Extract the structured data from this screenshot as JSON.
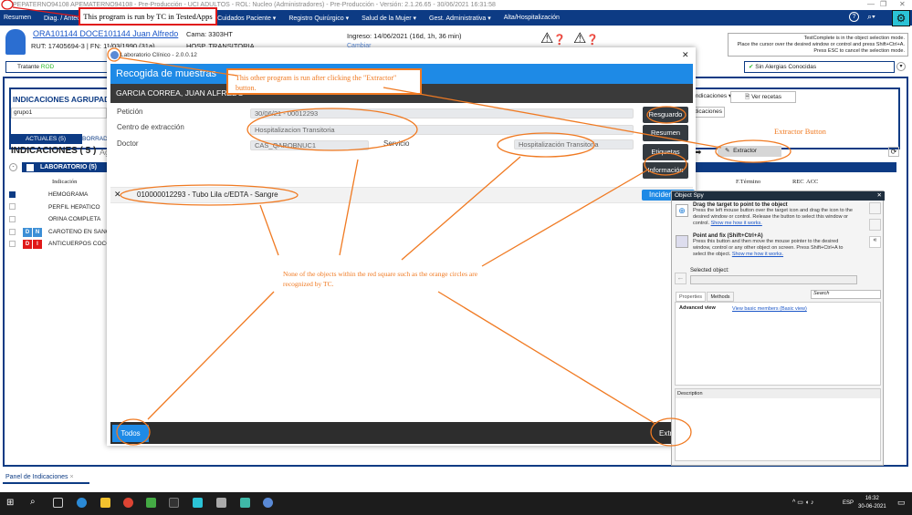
{
  "window": {
    "title": "PEPATERNO94108 APEMATERNO94108 - Pre-Producción - UCI ADULTOS - ROL: Nucleo (Administradores) - Pre-Producción - Versión: 2.1.26.65 - 30/06/2021 16:31:58"
  },
  "menu": [
    "Resumen",
    "Diag. / Antec.",
    "Cuidados Paciente",
    "Registro Quirúrgico",
    "Salud de la Mujer",
    "Gest. Administrativa",
    "Alta/Hospitalización"
  ],
  "patient": {
    "name": "ORA101144 DOCE101144 Juan Alfredo",
    "rut": "RUT: 17405694-3 | FN: 11/03/1990 (31a)",
    "cama": "Cama: 3303HT",
    "unit": "HOSP. TRANSITORIA",
    "ingreso": "Ingreso: 14/06/2021 (16d, 1h, 36 min)",
    "cambiar": "Cambiar"
  },
  "tooltip": [
    "TestComplete is in the object selection mode.",
    "Place the cursor over the desired window or control and press Shift+Ctrl+A.",
    "Press ESC to cancel the selection mode."
  ],
  "tratante": {
    "label": "Tratante",
    "value": "ROD"
  },
  "alergias": "Sin Alergias Conocidas",
  "agrupadas": {
    "title": "INDICACIONES AGRUPADAS",
    "group": "grupo1",
    "dropdown": "Indicaciones",
    "btn": "Indicaciones",
    "ver_recetas": "Ver recetas"
  },
  "tabs": {
    "actuales": "ACTUALES (5)",
    "borradores": "BORRADORES"
  },
  "indicaciones_title": "INDICACIONES ( 5 )",
  "agregar": "Ag",
  "laboratorio": "LABORATORIO  (5)",
  "columns": {
    "indicacion": "Indicación",
    "termino": "F.Término",
    "rec": "REC",
    "acc": "ACC"
  },
  "rows": [
    {
      "name": "HEMOGRAMA",
      "checked": true,
      "badges": []
    },
    {
      "name": "PERFIL HEPATICO",
      "checked": false,
      "badges": []
    },
    {
      "name": "ORINA COMPLETA",
      "checked": false,
      "badges": []
    },
    {
      "name": "CAROTENO EN SANGRE",
      "checked": false,
      "badges": [
        {
          "t": "D",
          "c": "#3d8fd6"
        },
        {
          "t": "N",
          "c": "#3d8fd6"
        }
      ]
    },
    {
      "name": "ANTICUERPOS COCCIDIOIDES",
      "checked": false,
      "badges": [
        {
          "t": "D",
          "c": "#e01919"
        },
        {
          "t": "I",
          "c": "#e01919"
        }
      ]
    }
  ],
  "extractor": "Extractor",
  "dialog": {
    "title": "Laboratorio Clínico - 2.0.0.12",
    "header": "Recogida de muestras",
    "patient": "GARCIA CORREA, JUAN ALFREDO",
    "peticion_label": "Petición",
    "peticion": "30/06/21 - 00012293",
    "centro_label": "Centro de extracción",
    "centro": "Hospitalizacion Transitoria",
    "doctor_label": "Doctor",
    "doctor": "CAS_QAROBNUC1",
    "servicio_label": "Servicio",
    "servicio": "Hospitalización Transitoria",
    "buttons": [
      "Resguardo",
      "Resumen",
      "Etiquetas",
      "Información"
    ],
    "tube": "010000012293 - Tubo Lila c/EDTA - Sangre",
    "incidencia": "Incidencia",
    "todos": "Todos",
    "extraer": "Extraer"
  },
  "spy": {
    "title": "Object Spy",
    "drag_title": "Drag the target to point to the object",
    "drag_text": "Press the left mouse button over the target icon and drag the icon to the desired window or control. Release the button to select this window or control.",
    "show": "Show me how it works.",
    "fix_title": "Point and fix (Shift+Ctrl+A)",
    "fix_text": "Press this button and then move the mouse pointer to the desired window, control or any other object on screen. Press Shift+Ctrl+A to select the object.",
    "selected": "Selected object:",
    "tab_props": "Properties",
    "tab_methods": "Methods",
    "search": "Search",
    "advanced": "Advanced view",
    "basic": "View basic members (Basic view)",
    "description": "Description"
  },
  "bottom_tab": "Panel de Indicaciones",
  "clock": {
    "time": "16:32",
    "date": "30-06-2021",
    "lang": "ESP"
  },
  "annotations": {
    "tc": "This program is run by TC in TestedApps",
    "other": "This other program is run after clicking the \"Extractor\" button.",
    "extractor": "Extractor Button",
    "note": "None of the objects within the red square such as the orange circles are recognized by TC."
  },
  "colors": {
    "navy": "#0d3b84",
    "blue": "#1e8ae6",
    "red": "#e01919",
    "orange": "#f07a22"
  }
}
